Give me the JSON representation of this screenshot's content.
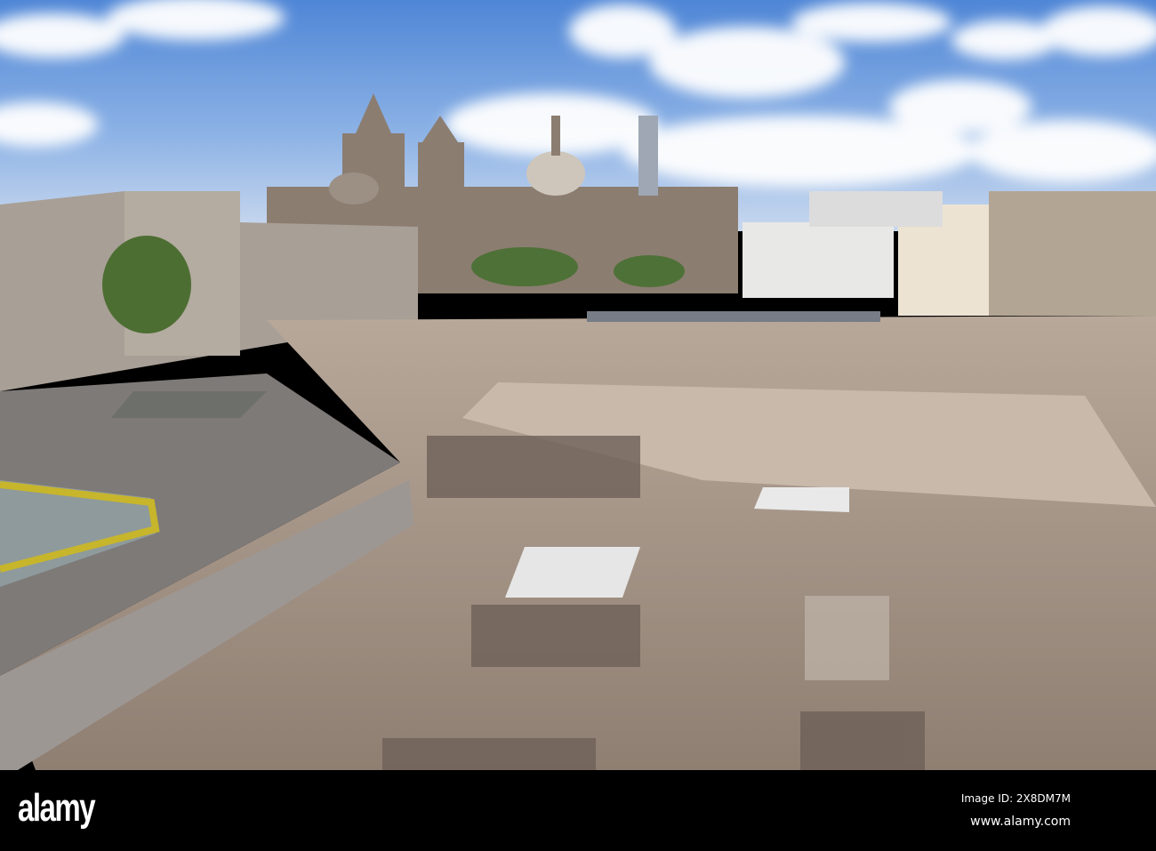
{
  "watermark": {
    "logo": "alamy",
    "image_id": "Image ID: 2X8DM7M",
    "website": "www.alamy.com"
  }
}
